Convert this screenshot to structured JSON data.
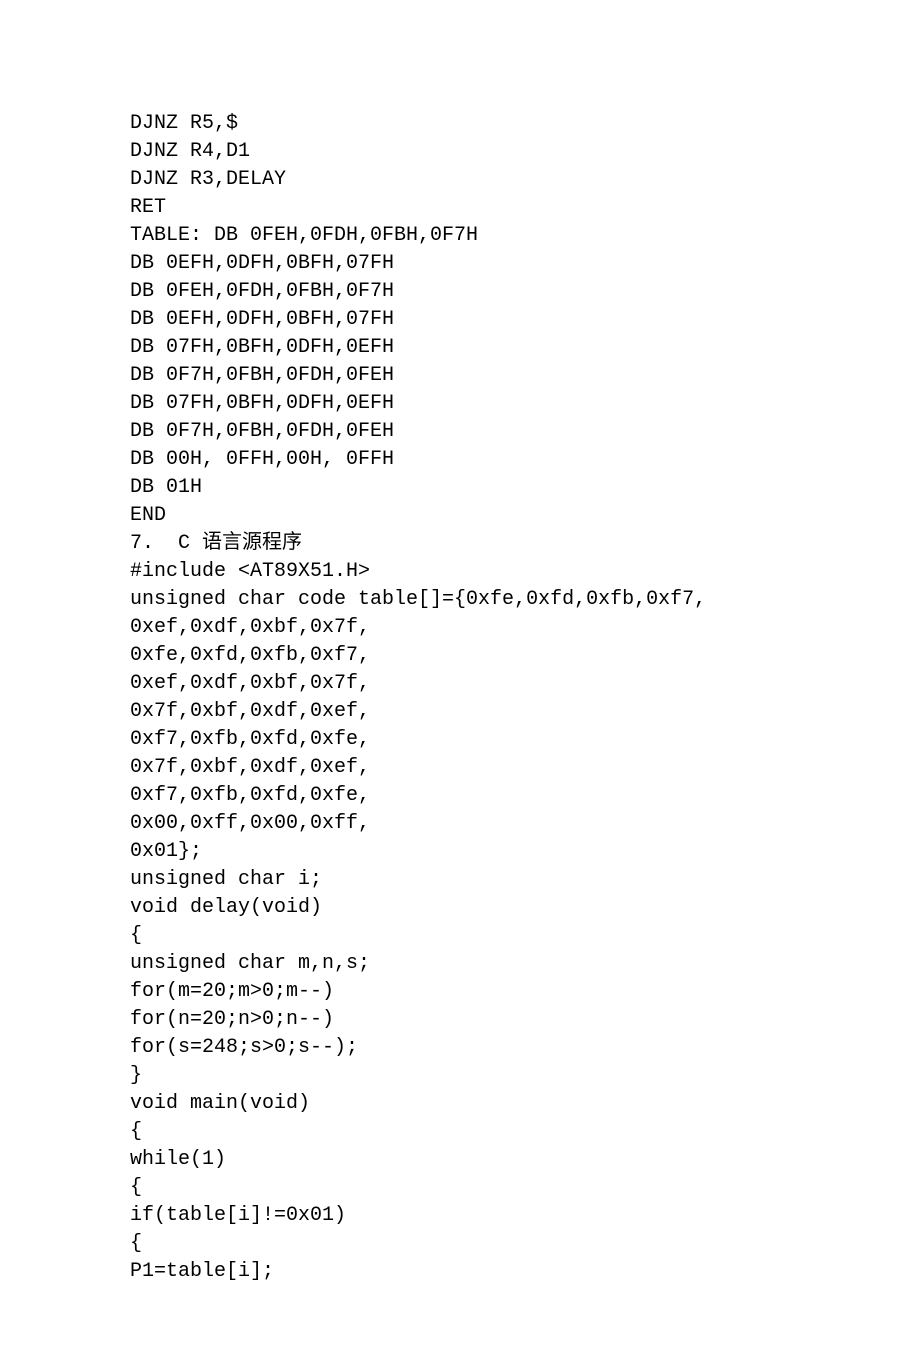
{
  "lines": [
    "DJNZ R5,$",
    "DJNZ R4,D1",
    "DJNZ R3,DELAY",
    "RET",
    "TABLE: DB 0FEH,0FDH,0FBH,0F7H",
    "DB 0EFH,0DFH,0BFH,07FH",
    "DB 0FEH,0FDH,0FBH,0F7H",
    "DB 0EFH,0DFH,0BFH,07FH",
    "DB 07FH,0BFH,0DFH,0EFH",
    "DB 0F7H,0FBH,0FDH,0FEH",
    "DB 07FH,0BFH,0DFH,0EFH",
    "DB 0F7H,0FBH,0FDH,0FEH",
    "DB 00H, 0FFH,00H, 0FFH",
    "DB 01H",
    "END",
    "7.  C 语言源程序",
    "#include <AT89X51.H>",
    "unsigned char code table[]={0xfe,0xfd,0xfb,0xf7,",
    "0xef,0xdf,0xbf,0x7f,",
    "0xfe,0xfd,0xfb,0xf7,",
    "0xef,0xdf,0xbf,0x7f,",
    "0x7f,0xbf,0xdf,0xef,",
    "0xf7,0xfb,0xfd,0xfe,",
    "0x7f,0xbf,0xdf,0xef,",
    "0xf7,0xfb,0xfd,0xfe,",
    "0x00,0xff,0x00,0xff,",
    "0x01};",
    "unsigned char i;",
    "",
    "void delay(void)",
    "{",
    "unsigned char m,n,s;",
    "for(m=20;m>0;m--)",
    "for(n=20;n>0;n--)",
    "for(s=248;s>0;s--);",
    "}",
    "",
    "void main(void)",
    "{",
    "while(1)",
    "{",
    "if(table[i]!=0x01)",
    "{",
    "P1=table[i];"
  ]
}
